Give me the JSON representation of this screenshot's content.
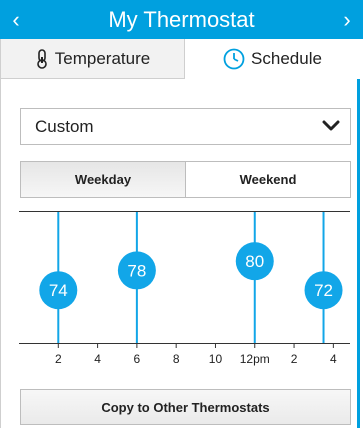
{
  "header": {
    "title": "My Thermostat",
    "back_icon": "chevron-left-icon",
    "forward_icon": "chevron-right-icon",
    "back_glyph": "‹",
    "forward_glyph": "›",
    "color": "#00a0df"
  },
  "tabs": [
    {
      "label": "Temperature",
      "icon": "thermometer-icon",
      "selected": false
    },
    {
      "label": "Schedule",
      "icon": "clock-icon",
      "selected": true
    }
  ],
  "schedule_select": {
    "value": "Custom",
    "icon": "chevron-down-icon"
  },
  "day_toggle": {
    "options": [
      "Weekday",
      "Weekend"
    ],
    "selected": "Weekday"
  },
  "schedule_chart": {
    "x_ticks": [
      "2",
      "4",
      "6",
      "8",
      "10",
      "12pm",
      "2",
      "4"
    ],
    "x_hours": [
      2,
      4,
      6,
      8,
      10,
      12,
      14,
      16
    ],
    "x_range": [
      0,
      17
    ],
    "setpoints": [
      {
        "hour": 2,
        "temp": "74",
        "level": 0.4
      },
      {
        "hour": 6,
        "temp": "78",
        "level": 0.55
      },
      {
        "hour": 12,
        "temp": "80",
        "level": 0.62
      },
      {
        "hour": 15.5,
        "temp": "72",
        "level": 0.4
      }
    ],
    "accent": "#12a6e8",
    "line_color": "#12a6e8"
  },
  "copy_button": {
    "label": "Copy to Other Thermostats"
  }
}
